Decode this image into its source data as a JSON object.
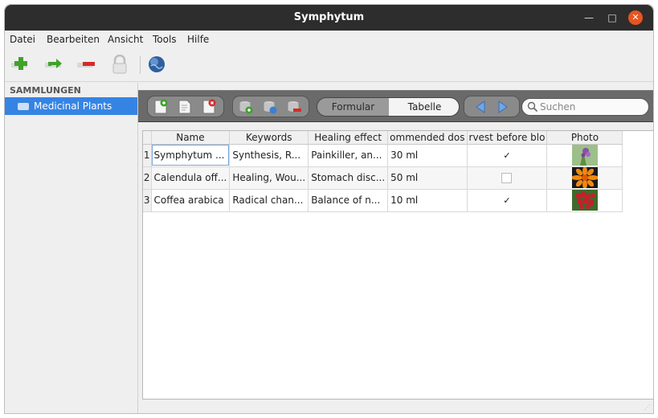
{
  "window": {
    "title": "Symphytum"
  },
  "menu": [
    "Datei",
    "Bearbeiten",
    "Ansicht",
    "Tools",
    "Hilfe"
  ],
  "sidebar": {
    "heading": "SAMMLUNGEN",
    "items": [
      {
        "label": "Medicinal Plants"
      }
    ]
  },
  "view_switch": {
    "formular": "Formular",
    "tabelle": "Tabelle",
    "selected": "Tabelle"
  },
  "search": {
    "placeholder": "Suchen",
    "value": ""
  },
  "table": {
    "columns": [
      "Name",
      "Keywords",
      "Healing effect",
      "ommended dos",
      "rvest before blo",
      "Photo"
    ],
    "rows": [
      {
        "num": "1",
        "name": "Symphytum ...",
        "keywords": "Synthesis, R...",
        "healing": "Painkiller, an...",
        "dose": "30 ml",
        "harvest": true,
        "photo": "purple-flower-photo"
      },
      {
        "num": "2",
        "name": "Calendula off...",
        "keywords": "Healing, Wou...",
        "healing": "Stomach disc...",
        "dose": "50 ml",
        "harvest": false,
        "photo": "orange-flower-photo"
      },
      {
        "num": "3",
        "name": "Coffea arabica",
        "keywords": "Radical chan...",
        "healing": "Balance of n...",
        "dose": "10 ml",
        "harvest": true,
        "photo": "coffee-berries-photo"
      }
    ]
  },
  "colors": {
    "accent": "#3584e4",
    "titlebar": "#2d2d2d",
    "close": "#e95420",
    "toolbar_dark": "#6a6a6a"
  }
}
